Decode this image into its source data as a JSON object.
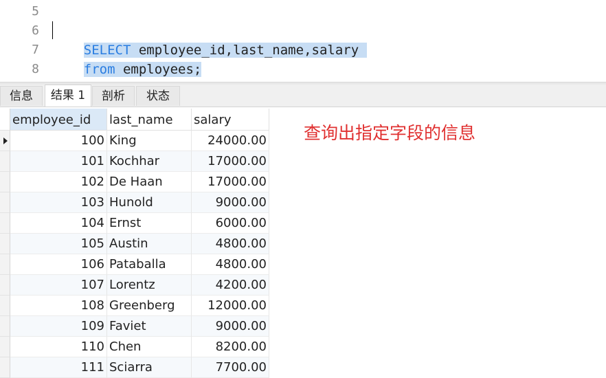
{
  "editor": {
    "line_numbers": [
      "5",
      "6",
      "7",
      "8"
    ],
    "lines": [
      {
        "keyword": "SELECT",
        "rest": " employee_id,last_name,salary "
      },
      {
        "keyword": "from",
        "rest": " employees;"
      }
    ]
  },
  "tabs": [
    {
      "label": "信息"
    },
    {
      "label": "结果 1"
    },
    {
      "label": "剖析"
    },
    {
      "label": "状态"
    }
  ],
  "grid": {
    "columns": [
      "employee_id",
      "last_name",
      "salary"
    ],
    "rows": [
      {
        "employee_id": "100",
        "last_name": "King",
        "salary": "24000.00"
      },
      {
        "employee_id": "101",
        "last_name": "Kochhar",
        "salary": "17000.00"
      },
      {
        "employee_id": "102",
        "last_name": "De Haan",
        "salary": "17000.00"
      },
      {
        "employee_id": "103",
        "last_name": "Hunold",
        "salary": "9000.00"
      },
      {
        "employee_id": "104",
        "last_name": "Ernst",
        "salary": "6000.00"
      },
      {
        "employee_id": "105",
        "last_name": "Austin",
        "salary": "4800.00"
      },
      {
        "employee_id": "106",
        "last_name": "Pataballa",
        "salary": "4800.00"
      },
      {
        "employee_id": "107",
        "last_name": "Lorentz",
        "salary": "4200.00"
      },
      {
        "employee_id": "108",
        "last_name": "Greenberg",
        "salary": "12000.00"
      },
      {
        "employee_id": "109",
        "last_name": "Faviet",
        "salary": "9000.00"
      },
      {
        "employee_id": "110",
        "last_name": "Chen",
        "salary": "8200.00"
      },
      {
        "employee_id": "111",
        "last_name": "Sciarra",
        "salary": "7700.00"
      }
    ]
  },
  "annotation": "查询出指定字段的信息",
  "colors": {
    "keyword": "#2a7de1",
    "selection": "#c7ddf4",
    "annotation": "#e03030",
    "header_selected": "#dbe9f7"
  }
}
